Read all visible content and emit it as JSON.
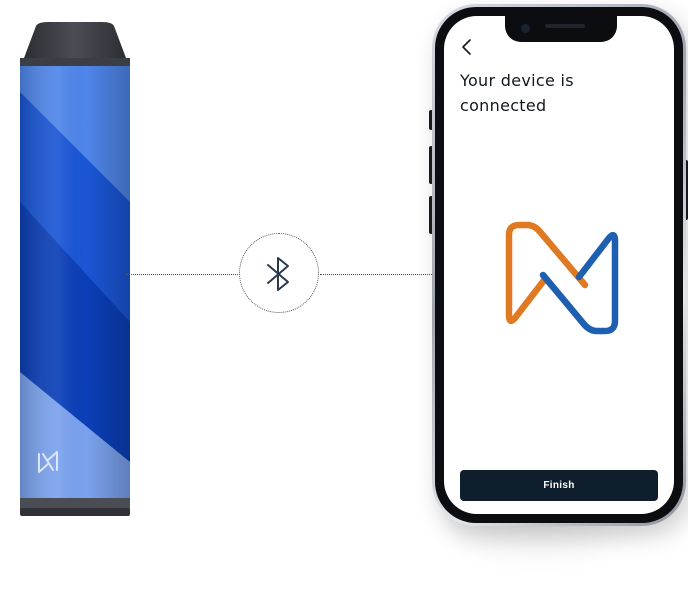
{
  "screen": {
    "title": "Your device is connected",
    "back_icon": "chevron-left-icon",
    "finish_label": "Finish"
  },
  "connector": {
    "icon": "bluetooth-icon"
  },
  "logos": {
    "app_logo": "brand-n-logo",
    "device_logo": "brand-n-logo"
  },
  "colors": {
    "accent_orange": "#e07a22",
    "accent_blue": "#1f5fb0",
    "button_bg": "#0f1e2c",
    "device_blue": "#1a56d6"
  }
}
